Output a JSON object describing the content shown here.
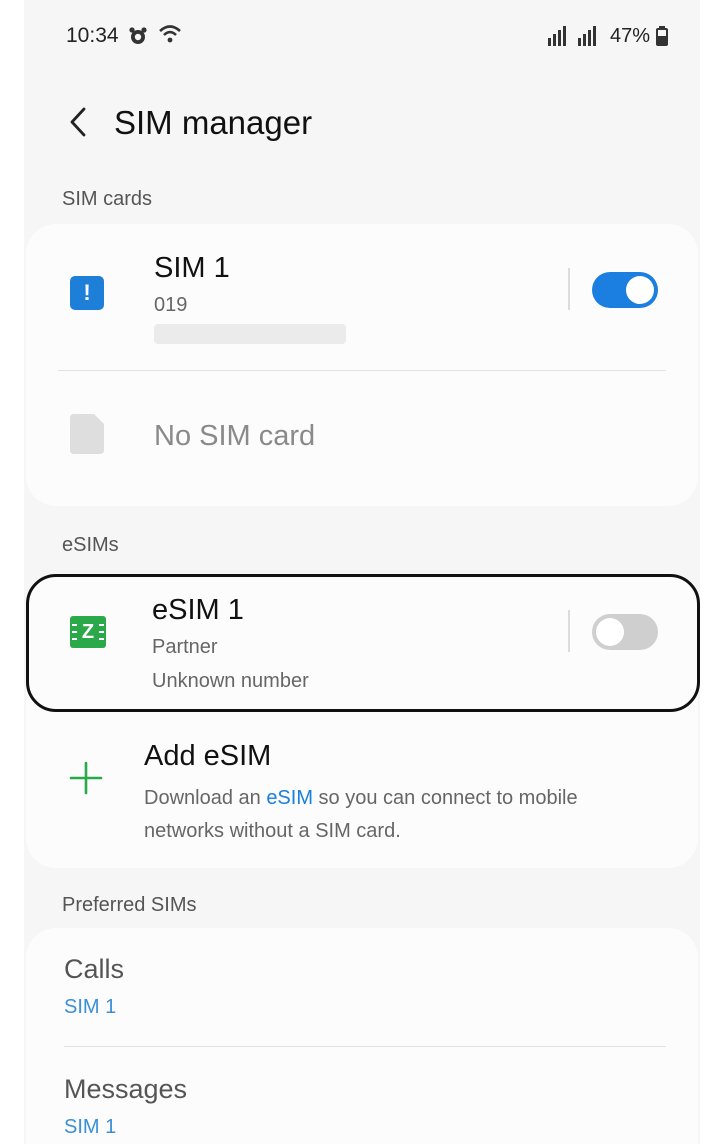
{
  "status_bar": {
    "time": "10:34",
    "battery": "47%",
    "icons": [
      "alarm-icon",
      "wifi-icon",
      "signal-icon",
      "battery-icon"
    ]
  },
  "header": {
    "title": "SIM manager"
  },
  "sim_cards": {
    "section_label": "SIM cards",
    "sim1": {
      "title": "SIM 1",
      "number": "019",
      "enabled": true
    },
    "empty_slot": {
      "title": "No SIM card"
    }
  },
  "esims": {
    "section_label": "eSIMs",
    "esim1": {
      "title": "eSIM 1",
      "carrier": "Partner",
      "number": "Unknown number",
      "enabled": false,
      "icon_letter": "Z"
    },
    "add": {
      "title": "Add eSIM",
      "desc_before": "Download an ",
      "desc_link": "eSIM",
      "desc_after": " so you can connect to mobile networks without a SIM card."
    }
  },
  "preferred": {
    "section_label": "Preferred SIMs",
    "calls": {
      "title": "Calls",
      "value": "SIM 1"
    },
    "messages": {
      "title": "Messages",
      "value": "SIM 1"
    }
  },
  "colors": {
    "accent": "#1a7fe0",
    "sim_icon": "#1e7fd9",
    "esim_icon": "#2aa84a",
    "plus": "#2aa84a"
  }
}
